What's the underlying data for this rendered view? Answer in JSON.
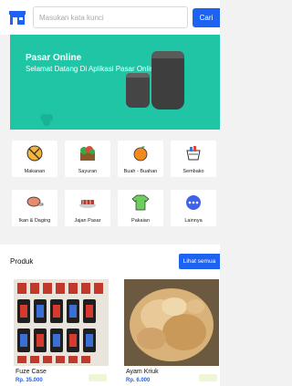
{
  "header": {
    "search_placeholder": "Masukan kata kunci",
    "search_button": "Cari"
  },
  "banner": {
    "title": "Pasar Online",
    "subtitle": "Selamat Datang Di Aplikasi Pasar Online",
    "background_color": "#20c5a6"
  },
  "categories": [
    {
      "label": "Makanan",
      "icon": "food-icon"
    },
    {
      "label": "Sayuran",
      "icon": "vegetable-icon"
    },
    {
      "label": "Buah - Buahan",
      "icon": "fruit-icon"
    },
    {
      "label": "Sembako",
      "icon": "groceries-icon"
    },
    {
      "label": "Ikan & Daging",
      "icon": "fish-meat-icon"
    },
    {
      "label": "Jajan Pasar",
      "icon": "snack-icon"
    },
    {
      "label": "Pakaian",
      "icon": "clothing-icon"
    },
    {
      "label": "Lainnya",
      "icon": "more-icon"
    }
  ],
  "produk": {
    "title": "Produk",
    "see_all": "Lihat semua"
  },
  "products": [
    {
      "name": "Fuze Case",
      "price": "Rp. 35.000"
    },
    {
      "name": "Ayam Kriuk",
      "price": "Rp. 6.000"
    }
  ],
  "colors": {
    "accent": "#1d62f0",
    "banner": "#20c5a6"
  }
}
